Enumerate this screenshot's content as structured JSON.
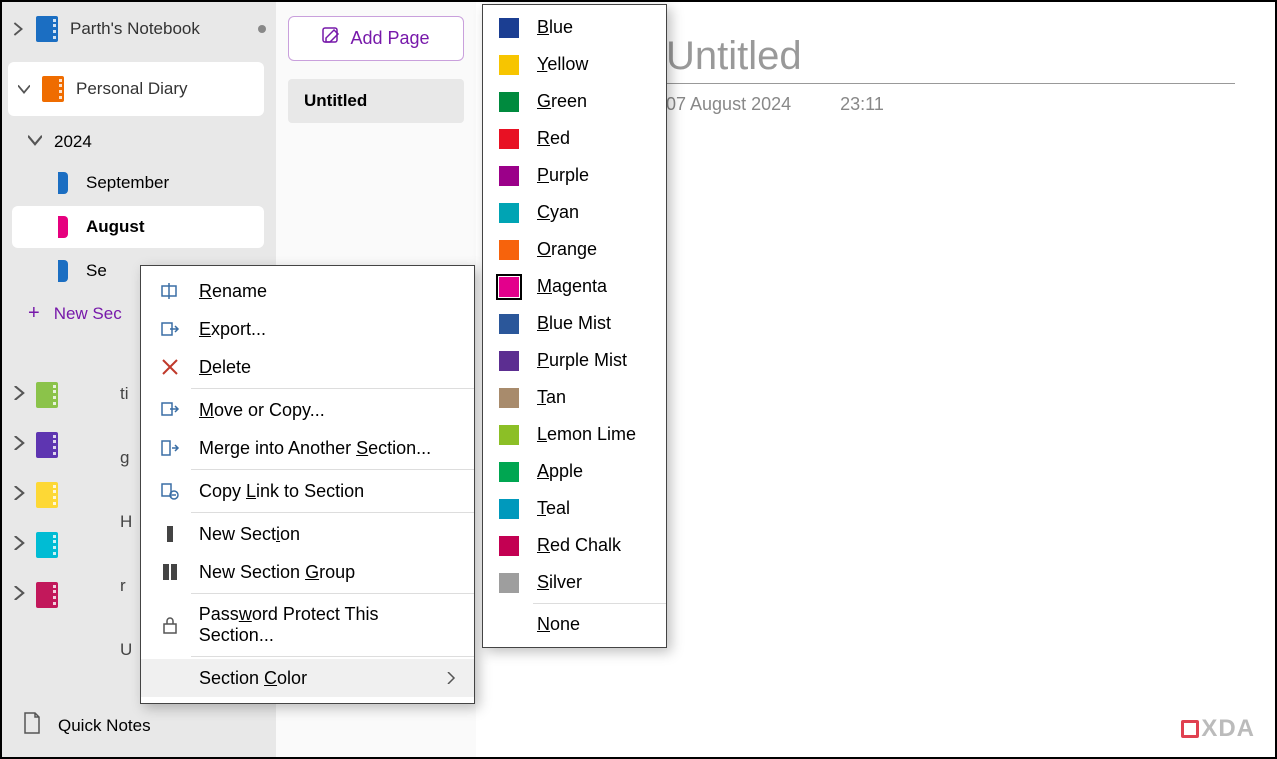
{
  "notebooks": {
    "primary": {
      "name": "Parth's Notebook",
      "color": "#1b6ec2"
    },
    "selected": {
      "name": "Personal Diary",
      "color": "#ef6c00"
    }
  },
  "year": "2024",
  "sections": {
    "september": {
      "label": "September",
      "color": "#1b6ec2"
    },
    "august": {
      "label": "August",
      "color": "#e6007e"
    },
    "fragment": "Se"
  },
  "new_section_label": "New Sec",
  "mini_fragments": [
    "ti",
    "g",
    "H",
    "r",
    "U"
  ],
  "mini_colors": [
    "#8bc34a",
    "#5e35b1",
    "#fdd835",
    "#00bcd4",
    "#c2185b"
  ],
  "quick_notes_label": "Quick Notes",
  "add_page_label": "Add Page",
  "page_item_label": "Untitled",
  "note_title": "Untitled",
  "note_date": "07 August 2024",
  "note_time": "23:11",
  "ctx": {
    "rename": "Rename",
    "export": "Export...",
    "delete": "Delete",
    "move": "Move or Copy...",
    "merge": "Merge into Another Section...",
    "copylink": "Copy Link to Section",
    "newsection": "New Section",
    "newgroup": "New Section Group",
    "password": "Password Protect This Section...",
    "sectioncolor": "Section Color"
  },
  "colors": [
    {
      "name": "Blue",
      "hex": "#1b3e92"
    },
    {
      "name": "Yellow",
      "hex": "#f7c500"
    },
    {
      "name": "Green",
      "hex": "#008a3e"
    },
    {
      "name": "Red",
      "hex": "#e81123"
    },
    {
      "name": "Purple",
      "hex": "#9b0089"
    },
    {
      "name": "Cyan",
      "hex": "#00a4b4"
    },
    {
      "name": "Orange",
      "hex": "#f7630c"
    },
    {
      "name": "Magenta",
      "hex": "#e3008c",
      "selected": true
    },
    {
      "name": "Blue Mist",
      "hex": "#2b579a"
    },
    {
      "name": "Purple Mist",
      "hex": "#5c2e91"
    },
    {
      "name": "Tan",
      "hex": "#a88b6c"
    },
    {
      "name": "Lemon Lime",
      "hex": "#8cbf26"
    },
    {
      "name": "Apple",
      "hex": "#00a651"
    },
    {
      "name": "Teal",
      "hex": "#0099bc"
    },
    {
      "name": "Red Chalk",
      "hex": "#c30052"
    },
    {
      "name": "Silver",
      "hex": "#9e9e9e"
    }
  ],
  "none_label": "None",
  "watermark": "XDA"
}
